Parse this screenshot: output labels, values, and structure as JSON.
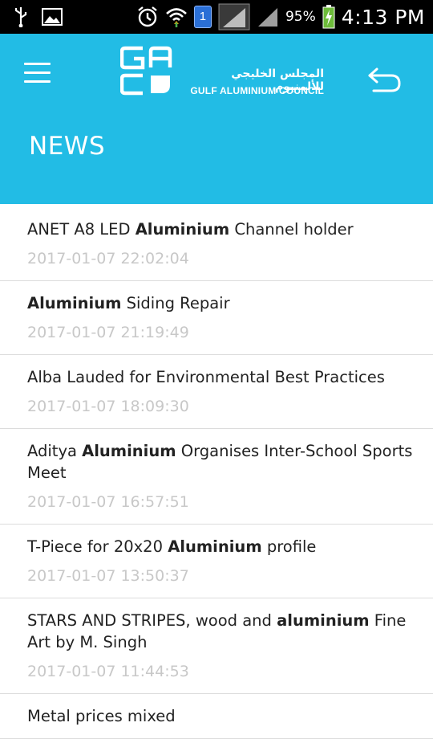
{
  "status_bar": {
    "battery_percent": "95%",
    "time": "4:13 PM",
    "notification_badge": "1",
    "icons": [
      "usb-icon",
      "gallery-icon",
      "alarm-icon",
      "wifi-icon",
      "notification-badge-icon",
      "signal-icon",
      "battery-icon"
    ]
  },
  "header": {
    "logo_letters": "GAC",
    "logo_arabic": "المجلس الخليجي للألمنيوم",
    "logo_english": "GULF ALUMINIUM COUNCIL",
    "page_title": "NEWS",
    "background_color": "#22bce5",
    "menu_icon": "hamburger-menu-icon",
    "back_icon": "back-arrow-icon"
  },
  "news": [
    {
      "title_parts": [
        {
          "text": "ANET A8 LED ",
          "bold": false
        },
        {
          "text": "Aluminium",
          "bold": true
        },
        {
          "text": " Channel holder",
          "bold": false
        }
      ],
      "date": "2017-01-07 22:02:04"
    },
    {
      "title_parts": [
        {
          "text": "Aluminium",
          "bold": true
        },
        {
          "text": " Siding Repair",
          "bold": false
        }
      ],
      "date": "2017-01-07 21:19:49"
    },
    {
      "title_parts": [
        {
          "text": "Alba Lauded for Environmental Best Practices",
          "bold": false
        }
      ],
      "date": "2017-01-07 18:09:30"
    },
    {
      "title_parts": [
        {
          "text": "Aditya ",
          "bold": false
        },
        {
          "text": "Aluminium",
          "bold": true
        },
        {
          "text": " Organises Inter-School Sports Meet",
          "bold": false
        }
      ],
      "date": "2017-01-07 16:57:51"
    },
    {
      "title_parts": [
        {
          "text": "T-Piece for 20x20 ",
          "bold": false
        },
        {
          "text": "Aluminium",
          "bold": true
        },
        {
          "text": " profile",
          "bold": false
        }
      ],
      "date": "2017-01-07 13:50:37"
    },
    {
      "title_parts": [
        {
          "text": "STARS AND STRIPES, wood and ",
          "bold": false
        },
        {
          "text": "aluminium",
          "bold": true
        },
        {
          "text": " Fine Art by M. Singh",
          "bold": false
        }
      ],
      "date": "2017-01-07 11:44:53"
    },
    {
      "title_parts": [
        {
          "text": "Metal prices mixed",
          "bold": false
        }
      ],
      "date": ""
    }
  ]
}
